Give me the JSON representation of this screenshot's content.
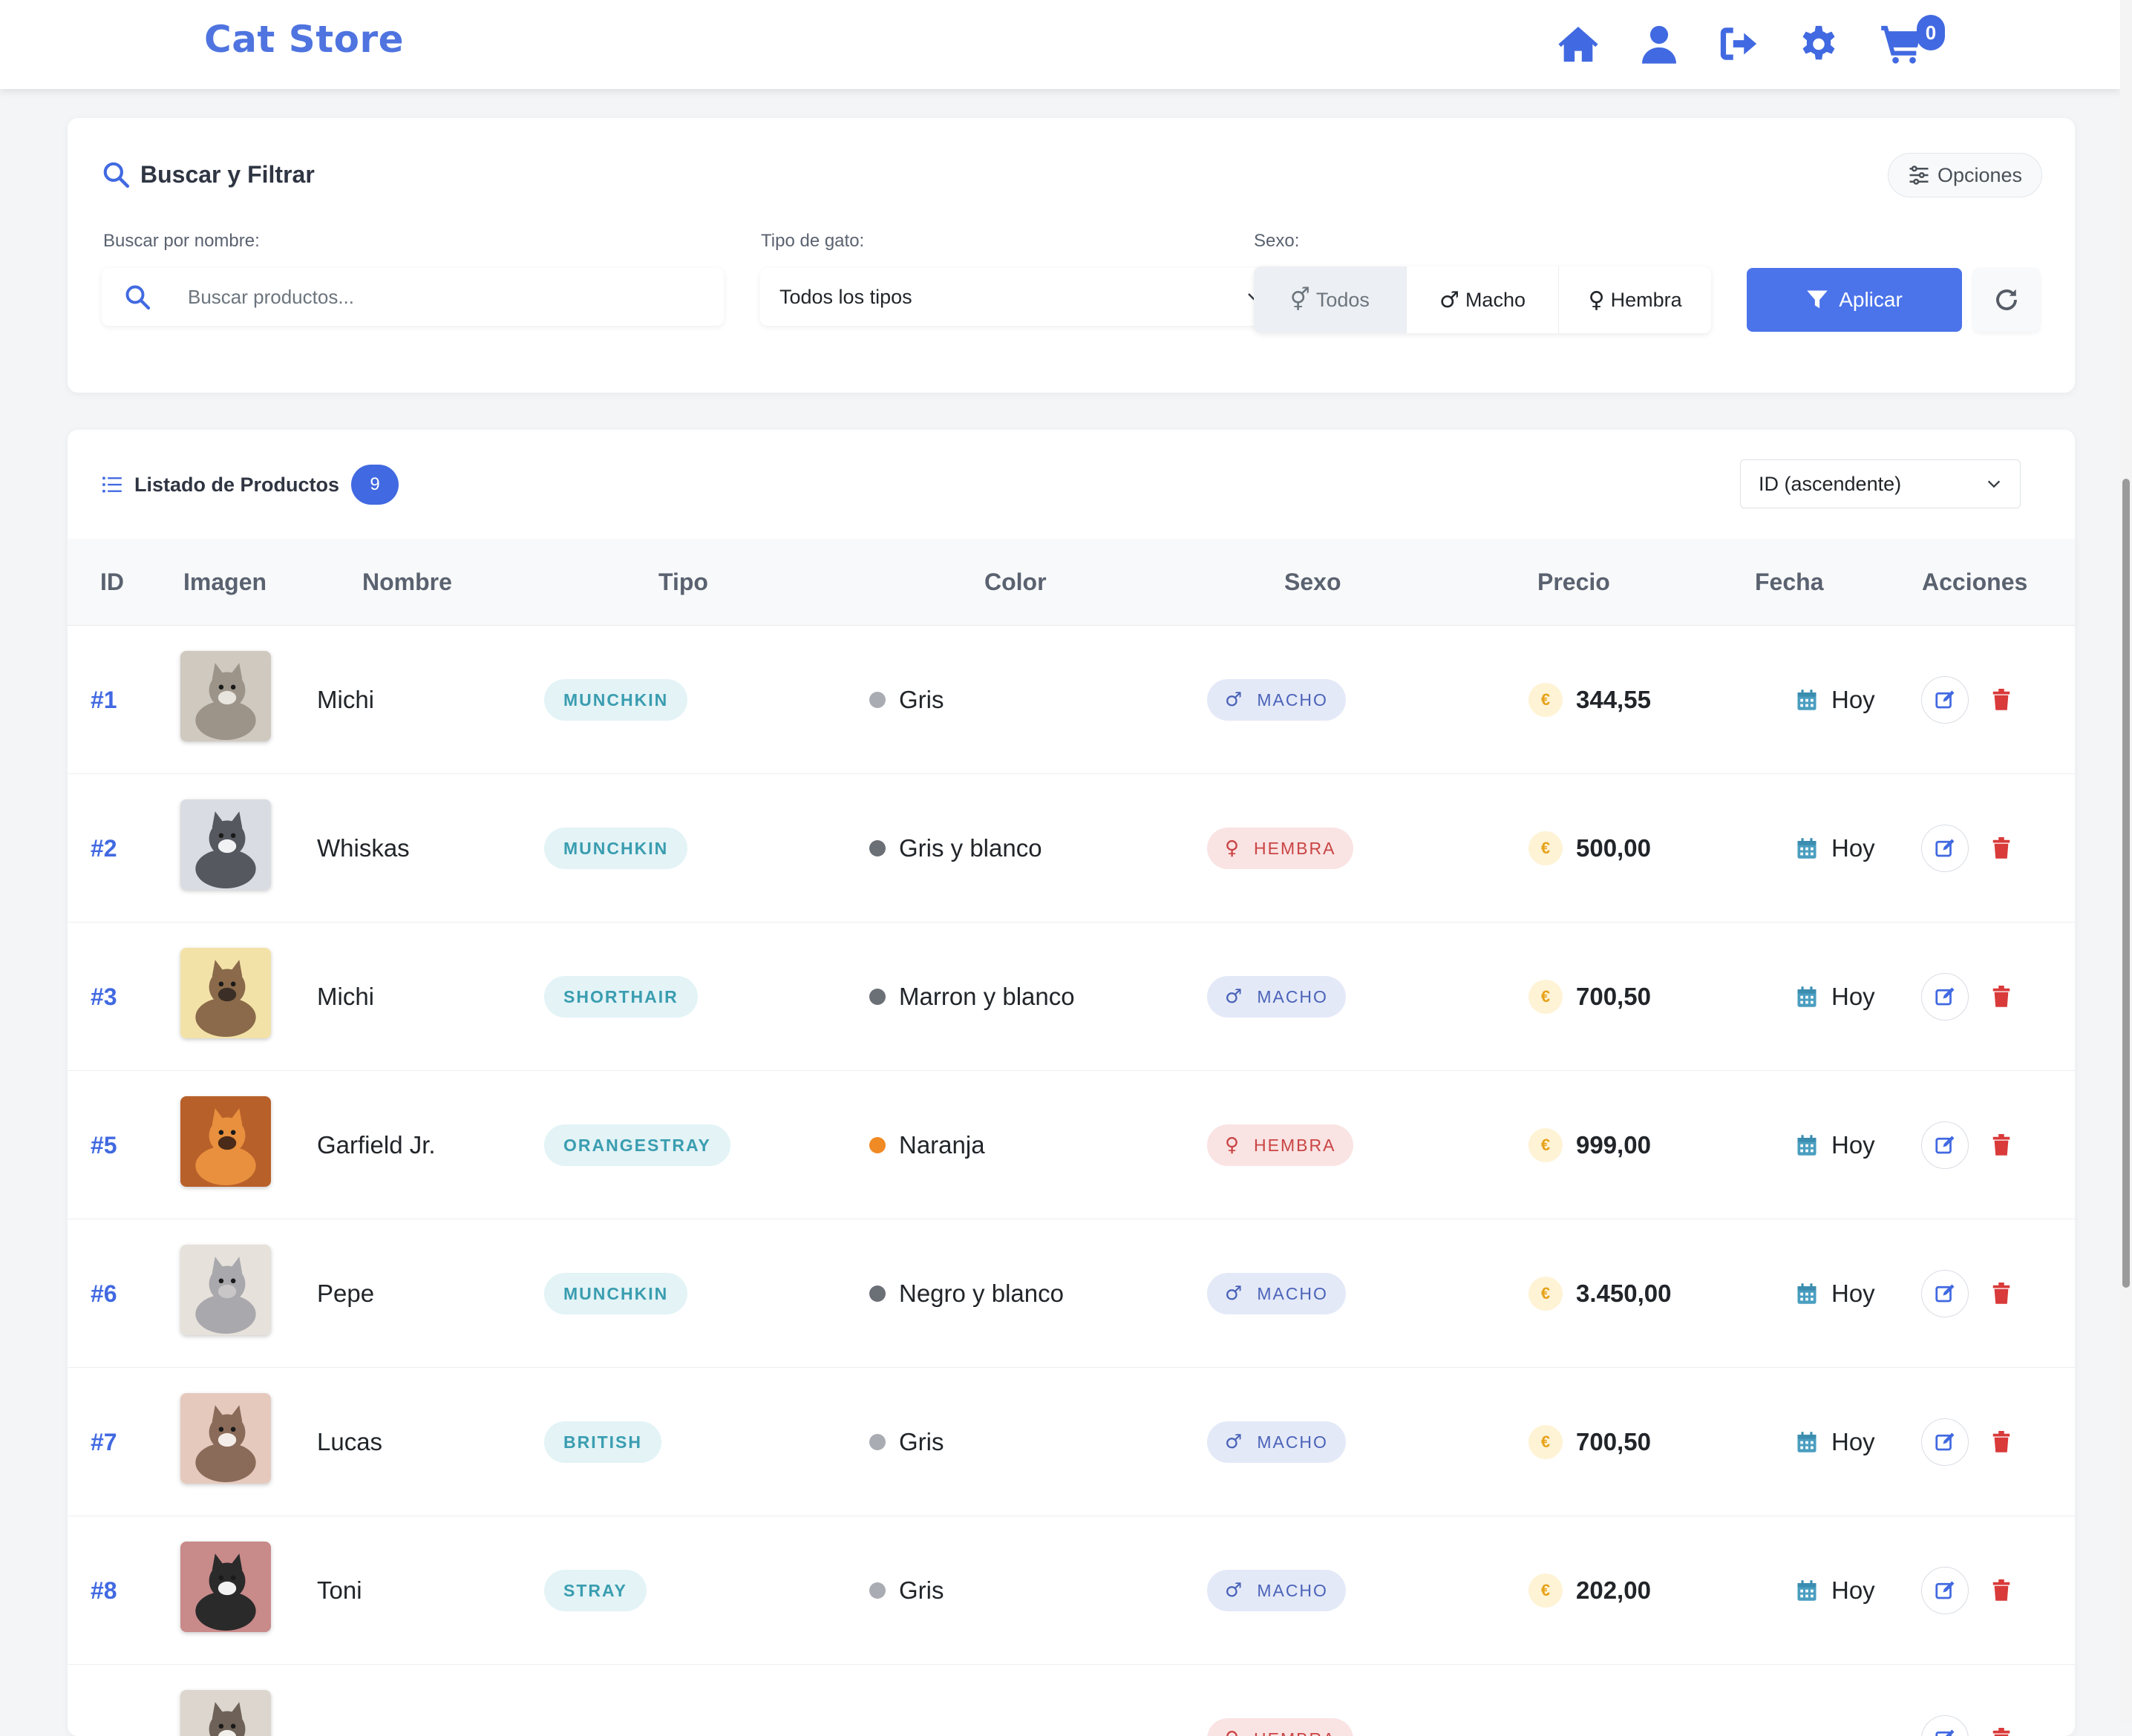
{
  "navbar": {
    "brand": "Cat Store",
    "icons": [
      "home-icon",
      "user-icon",
      "logout-icon",
      "gear-icon",
      "cart-icon"
    ],
    "cart_count": "0"
  },
  "filter": {
    "title": "Buscar y Filtrar",
    "options_label": "Opciones",
    "search_label": "Buscar por nombre:",
    "search_placeholder": "Buscar productos...",
    "search_value": "",
    "type_label": "Tipo de gato:",
    "type_selected": "Todos los tipos",
    "sex_label": "Sexo:",
    "sex_options": [
      {
        "symbol": "⚥",
        "label": "Todos"
      },
      {
        "symbol": "♂",
        "label": "Macho"
      },
      {
        "symbol": "♀",
        "label": "Hembra"
      }
    ],
    "sex_selected": "Todos",
    "apply_label": "Aplicar"
  },
  "list": {
    "title": "Listado de Productos",
    "count": "9",
    "sort_selected": "ID (ascendente)",
    "columns": [
      "ID",
      "Imagen",
      "Nombre",
      "Tipo",
      "Color",
      "Sexo",
      "Precio",
      "Fecha",
      "Acciones"
    ],
    "rows": [
      {
        "id": "#1",
        "name": "Michi",
        "type": "MUNCHKIN",
        "color": "Gris",
        "dot": "#a9acb2",
        "sex": "MACHO",
        "price": "344,55",
        "date": "Hoy"
      },
      {
        "id": "#2",
        "name": "Whiskas",
        "type": "MUNCHKIN",
        "color": "Gris y blanco",
        "dot": "#6b6f76",
        "sex": "HEMBRA",
        "price": "500,00",
        "date": "Hoy"
      },
      {
        "id": "#3",
        "name": "Michi",
        "type": "SHORTHAIR",
        "color": "Marron y blanco",
        "dot": "#6b6f76",
        "sex": "MACHO",
        "price": "700,50",
        "date": "Hoy"
      },
      {
        "id": "#5",
        "name": "Garfield Jr.",
        "type": "ORANGESTRAY",
        "color": "Naranja",
        "dot": "#f08a24",
        "sex": "HEMBRA",
        "price": "999,00",
        "date": "Hoy"
      },
      {
        "id": "#6",
        "name": "Pepe",
        "type": "MUNCHKIN",
        "color": "Negro y blanco",
        "dot": "#6b6f76",
        "sex": "MACHO",
        "price": "3.450,00",
        "date": "Hoy"
      },
      {
        "id": "#7",
        "name": "Lucas",
        "type": "BRITISH",
        "color": "Gris",
        "dot": "#a9acb2",
        "sex": "MACHO",
        "price": "700,50",
        "date": "Hoy"
      },
      {
        "id": "#8",
        "name": "Toni",
        "type": "STRAY",
        "color": "Gris",
        "dot": "#a9acb2",
        "sex": "MACHO",
        "price": "202,00",
        "date": "Hoy"
      },
      {
        "id": "",
        "name": "",
        "type": "",
        "color": "",
        "dot": "#ffffff",
        "sex": "HEMBRA",
        "price": "",
        "date": ""
      }
    ]
  },
  "colors": {
    "accent": "#4169e1",
    "male_bg": "#e4e9f8",
    "female_bg": "#fae3e3",
    "type_pill_bg": "#e3f3f6"
  }
}
